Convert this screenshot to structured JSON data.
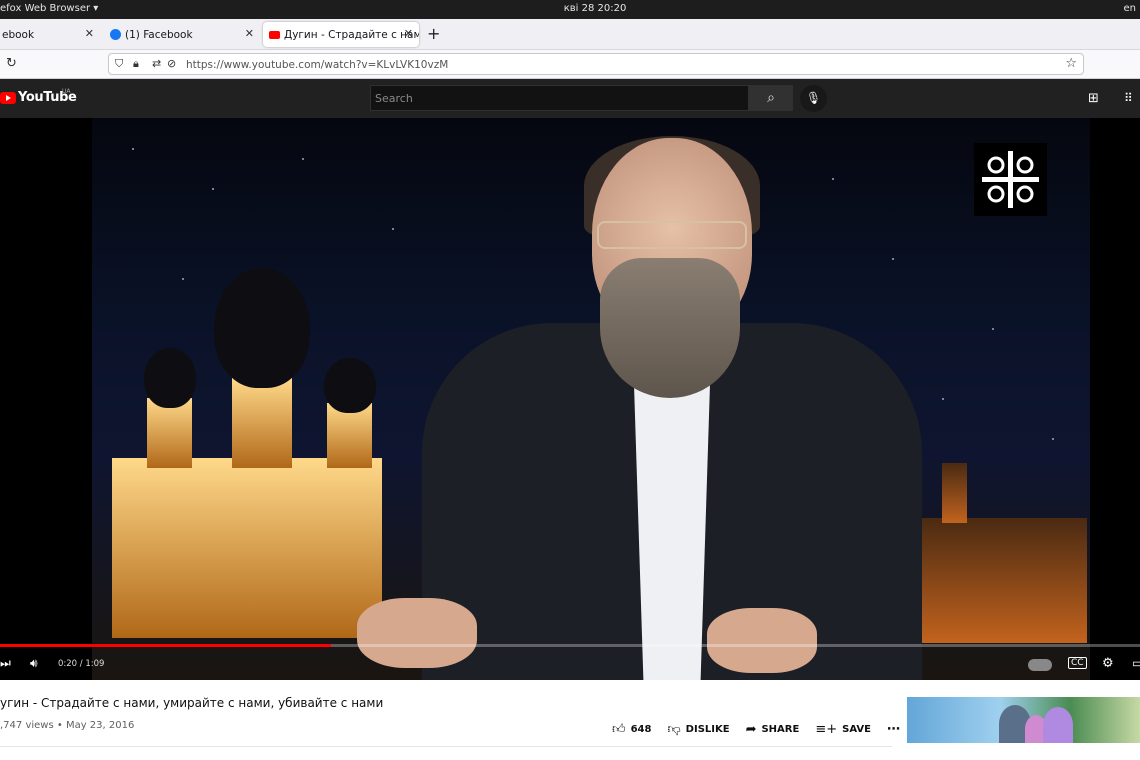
{
  "system": {
    "app_name": "efox Web Browser ▾",
    "clock": "кві 28  20:20",
    "lang": "en"
  },
  "tabs": [
    {
      "title": "ebook",
      "favicon_color": "#1877f2"
    },
    {
      "title": "(1) Facebook",
      "favicon_color": "#1877f2"
    },
    {
      "title": "Дугин - Страдайте с нами, ум",
      "favicon_color": "#ff0000",
      "active": true
    }
  ],
  "urlbar": {
    "url": "https://www.youtube.com/watch?v=KLvLVK10vzM"
  },
  "youtube": {
    "logo_text": "YouTube",
    "region": "UA",
    "search_placeholder": "Search"
  },
  "player": {
    "time": "0:20 / 1:09",
    "progress": 0.29
  },
  "video": {
    "title": "угин - Страдайте с нами, умирайте с нами, убивайте с нами",
    "meta": ",747 views • May 23, 2016",
    "like_count": "648",
    "dislike_label": "DISLIKE",
    "share_label": "SHARE",
    "save_label": "SAVE"
  },
  "colors": {
    "accent": "#ff0000",
    "masthead": "#212121"
  }
}
